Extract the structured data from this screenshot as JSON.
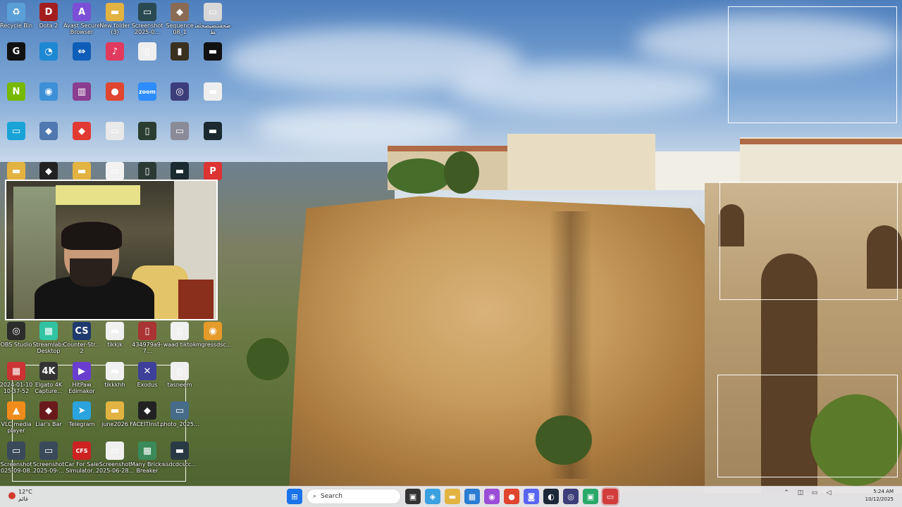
{
  "desktop": {
    "icons": [
      {
        "id": "recycle-bin",
        "label": "Recycle Bin",
        "color": "#5aa0d8",
        "glyph": "♻"
      },
      {
        "id": "dota2",
        "label": "Dota 2",
        "color": "#a31f1f",
        "glyph": "D"
      },
      {
        "id": "avast",
        "label": "Avast Secure Browser",
        "color": "#7b4fd6",
        "glyph": "A"
      },
      {
        "id": "new-folder",
        "label": "New folder (3)",
        "color": "#e3b341",
        "glyph": "▬"
      },
      {
        "id": "screenshot1",
        "label": "Screenshot 2025-0...",
        "color": "#2a4a52",
        "glyph": "▭"
      },
      {
        "id": "sequence",
        "label": "Sequence 08_1",
        "color": "#8a6c55",
        "glyph": "◆"
      },
      {
        "id": "file-ar",
        "label": "ضحقتنضپصحلعنط",
        "color": "#d8d8d8",
        "glyph": "▭"
      },
      {
        "id": "logitech",
        "label": "",
        "color": "#111111",
        "glyph": "G"
      },
      {
        "id": "edge-app",
        "label": "",
        "color": "#1e88d3",
        "glyph": "◔"
      },
      {
        "id": "teamviewer",
        "label": "",
        "color": "#0e5db8",
        "glyph": "⇔"
      },
      {
        "id": "tiktok-app",
        "label": "",
        "color": "#e23a5f",
        "glyph": "♪"
      },
      {
        "id": "blank-doc",
        "label": "",
        "color": "#efefef",
        "glyph": "▯"
      },
      {
        "id": "video-thumb",
        "label": "",
        "color": "#3a3020",
        "glyph": "▮"
      },
      {
        "id": "black-file",
        "label": "",
        "color": "#111111",
        "glyph": "▬"
      },
      {
        "id": "nvidia",
        "label": "",
        "color": "#76b900",
        "glyph": "N"
      },
      {
        "id": "browser-2",
        "label": "",
        "color": "#3d8fd6",
        "glyph": "◉"
      },
      {
        "id": "winrar",
        "label": "",
        "color": "#8b3d8f",
        "glyph": "▥"
      },
      {
        "id": "chrome",
        "label": "",
        "color": "#e0452f",
        "glyph": "●"
      },
      {
        "id": "zoom",
        "label": "",
        "color": "#2d8cff",
        "glyph": "zoom"
      },
      {
        "id": "obs-2",
        "label": "",
        "color": "#3d3d7a",
        "glyph": "◎"
      },
      {
        "id": "white-file",
        "label": "",
        "color": "#eeeeee",
        "glyph": "▬"
      },
      {
        "id": "monitor",
        "label": "",
        "color": "#19a3d6",
        "glyph": "▭"
      },
      {
        "id": "game-1",
        "label": "",
        "color": "#5078b0",
        "glyph": "◆"
      },
      {
        "id": "anydesk",
        "label": "",
        "color": "#e03a33",
        "glyph": "◆"
      },
      {
        "id": "screenshot-2",
        "label": "",
        "color": "#e9e9e9",
        "glyph": "▭"
      },
      {
        "id": "phone-shot",
        "label": "",
        "color": "#2a3e32",
        "glyph": "▯"
      },
      {
        "id": "shot-3",
        "label": "",
        "color": "#8a8a99",
        "glyph": "▭"
      },
      {
        "id": "dark-file",
        "label": "",
        "color": "#1b2a30",
        "glyph": "▬"
      },
      {
        "id": "folder-2",
        "label": "",
        "color": "#e3b341",
        "glyph": "▬"
      },
      {
        "id": "faceit",
        "label": "",
        "color": "#222",
        "glyph": "◆"
      },
      {
        "id": "folder-3",
        "label": "",
        "color": "#e3b341",
        "glyph": "▬"
      },
      {
        "id": "doc-2",
        "label": "",
        "color": "#f2f2f2",
        "glyph": "▭"
      },
      {
        "id": "phone-2",
        "label": "",
        "color": "#2b3a34",
        "glyph": "▯"
      },
      {
        "id": "dark-2",
        "label": "",
        "color": "#1b2a30",
        "glyph": "▬"
      },
      {
        "id": "pdf",
        "label": "",
        "color": "#d33",
        "glyph": "P"
      }
    ],
    "bottom_icons": [
      {
        "id": "obs-studio",
        "label": "OBS Studio",
        "color": "#2c2c2c",
        "glyph": "◎"
      },
      {
        "id": "streamlabs",
        "label": "Streamlabs Desktop",
        "color": "#31c3a2",
        "glyph": "▦"
      },
      {
        "id": "counter-strike",
        "label": "Counter-Str... 2",
        "color": "#1f3a6e",
        "glyph": "CS"
      },
      {
        "id": "tikkjk",
        "label": "tikkjk",
        "color": "#f0f0f0",
        "glyph": "▬"
      },
      {
        "id": "file-434",
        "label": "434979a9-7...",
        "color": "#a33",
        "glyph": "▯"
      },
      {
        "id": "waad-tiktok",
        "label": "waad tiktok",
        "color": "#f0f0f0",
        "glyph": "▯"
      },
      {
        "id": "imgressdsc",
        "label": "imgressdsc...",
        "color": "#e59b2a",
        "glyph": "◉"
      },
      {
        "id": "screenshot-2024",
        "label": "2024-01-10 10-37-52",
        "color": "#c33",
        "glyph": "▦"
      },
      {
        "id": "elgato",
        "label": "Elgato 4K Capture...",
        "color": "#333",
        "glyph": "4K"
      },
      {
        "id": "hitpaw",
        "label": "HitPaw Edimakor",
        "color": "#6a3fd0",
        "glyph": "▶"
      },
      {
        "id": "tikkkhh",
        "label": "tikkkhh",
        "color": "#f0f0f0",
        "glyph": "▬"
      },
      {
        "id": "exodus",
        "label": "Exodus",
        "color": "#3d3f9a",
        "glyph": "✕"
      },
      {
        "id": "tasneem",
        "label": "tasneem",
        "color": "#f0f0f0",
        "glyph": "▯"
      },
      {
        "id": "vlc",
        "label": "VLC media player",
        "color": "#f08c1c",
        "glyph": "▲"
      },
      {
        "id": "liars-bar",
        "label": "Liar's Bar",
        "color": "#6a1a1a",
        "glyph": "◆"
      },
      {
        "id": "telegram",
        "label": "Telegram",
        "color": "#2aa3de",
        "glyph": "➤"
      },
      {
        "id": "june2026",
        "label": "june2026",
        "color": "#e3b341",
        "glyph": "▬"
      },
      {
        "id": "faceit-inst",
        "label": "FACEITInst...",
        "color": "#222",
        "glyph": "◆"
      },
      {
        "id": "photo-2025",
        "label": "photo_2025...",
        "color": "#466c8a",
        "glyph": "▭"
      },
      {
        "id": "screenshot-0908",
        "label": "Screenshot 2025-09-08...",
        "color": "#3a4a5a",
        "glyph": "▭"
      },
      {
        "id": "screenshot-09",
        "label": "Screenshot 2025-09-...",
        "color": "#3a4a5a",
        "glyph": "▭"
      },
      {
        "id": "car-for-sale",
        "label": "Car For Sale Simulator...",
        "color": "#c22",
        "glyph": "CFS"
      },
      {
        "id": "screenshot-0628",
        "label": "Screenshot 2025-06-28...",
        "color": "#f0f0f0",
        "glyph": "▭"
      },
      {
        "id": "many-bricks",
        "label": "Many Bricks Breaker",
        "color": "#3a8a5a",
        "glyph": "▦"
      },
      {
        "id": "ssdc",
        "label": "ssdcdcscc...",
        "color": "#2a3a44",
        "glyph": "▬"
      }
    ]
  },
  "taskbar": {
    "weather": {
      "temp": "12°C",
      "desc": "غائم"
    },
    "search_placeholder": "Search",
    "clock": {
      "time": "5:24 AM",
      "date": "10/12/2025"
    },
    "apps": [
      {
        "id": "start",
        "glyph": "⊞",
        "color": "#1a73e8"
      },
      {
        "id": "task-view",
        "glyph": "▣",
        "color": "#333"
      },
      {
        "id": "copilot",
        "glyph": "◈",
        "color": "#3aa0e0"
      },
      {
        "id": "explorer",
        "glyph": "▬",
        "color": "#e3b341"
      },
      {
        "id": "store",
        "glyph": "▦",
        "color": "#2b7cd3"
      },
      {
        "id": "browser",
        "glyph": "◉",
        "color": "#9a4dd6"
      },
      {
        "id": "chrome",
        "glyph": "●",
        "color": "#e0452f"
      },
      {
        "id": "discord",
        "glyph": "◙",
        "color": "#5865f2"
      },
      {
        "id": "steam",
        "glyph": "◐",
        "color": "#1b2838"
      },
      {
        "id": "obs",
        "glyph": "◎",
        "color": "#3d3d7a"
      },
      {
        "id": "app-green",
        "glyph": "▣",
        "color": "#2aa86a"
      },
      {
        "id": "app-active",
        "glyph": "▭",
        "color": "#d33c3c"
      }
    ]
  }
}
